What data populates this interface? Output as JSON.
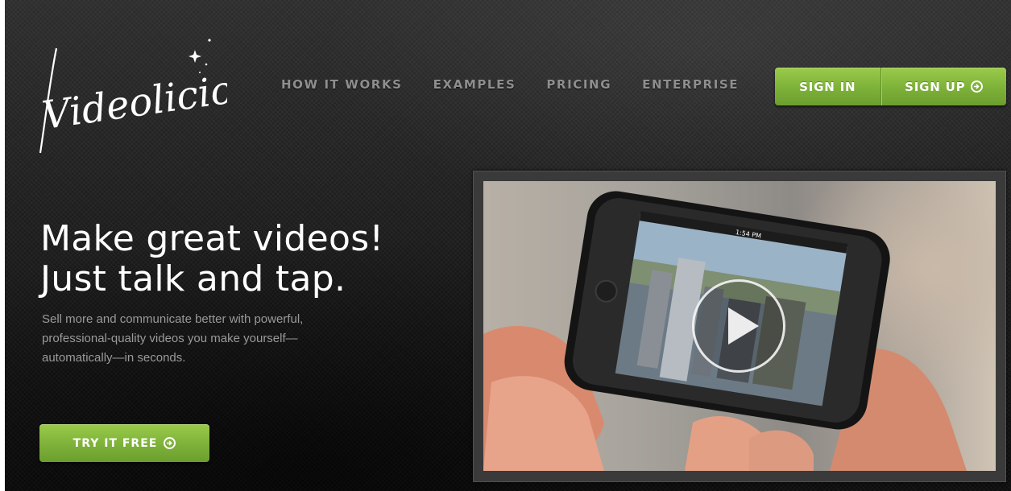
{
  "brand": {
    "logo_text": "Videolicious"
  },
  "nav": {
    "items": [
      {
        "label": "HOW IT WORKS"
      },
      {
        "label": "EXAMPLES"
      },
      {
        "label": "PRICING"
      },
      {
        "label": "ENTERPRISE"
      }
    ]
  },
  "auth": {
    "sign_in_label": "SIGN IN",
    "sign_up_label": "SIGN UP",
    "sign_up_icon": "circle-arrow-right-icon"
  },
  "hero": {
    "headline_line1": "Make great videos!",
    "headline_line2": "Just talk and tap.",
    "description": "Sell more and communicate better with powerful, professional-quality videos you make yourself—automatically—in seconds.",
    "cta_label": "TRY IT FREE",
    "cta_icon": "circle-arrow-right-icon"
  },
  "video": {
    "phone_status_time": "1:54 PM",
    "play_icon": "play-icon"
  },
  "colors": {
    "accent_green": "#7fb33a",
    "background_dark": "#1e1e1e",
    "nav_text": "#8e8e8e"
  }
}
